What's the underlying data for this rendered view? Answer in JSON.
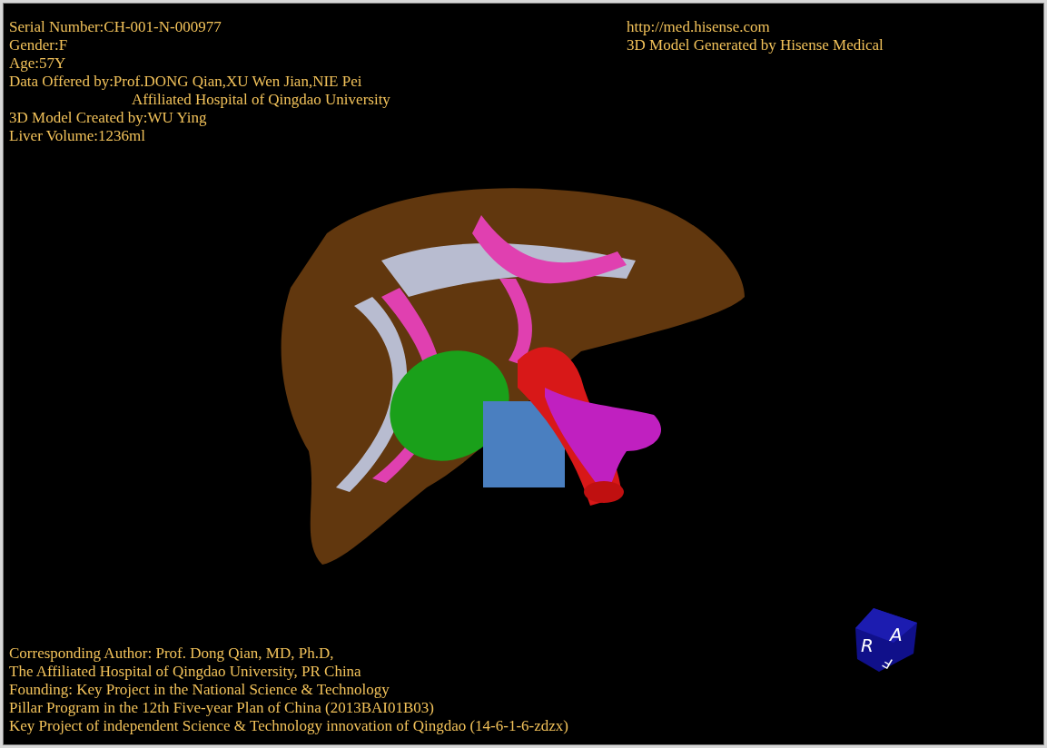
{
  "header_left": [
    {
      "text": "Serial Number:CH-001-N-000977",
      "indent": false
    },
    {
      "text": "Gender:F",
      "indent": false
    },
    {
      "text": "Age:57Y",
      "indent": false
    },
    {
      "text": "Data Offered by:Prof.DONG Qian,XU Wen Jian,NIE Pei",
      "indent": false
    },
    {
      "text": "Affiliated Hospital of Qingdao University",
      "indent": true
    },
    {
      "text": "3D Model Created by:WU Ying",
      "indent": false
    },
    {
      "text": "Liver Volume:1236ml",
      "indent": false
    }
  ],
  "header_right": [
    "http://med.hisense.com",
    "3D Model Generated by Hisense Medical"
  ],
  "model": {
    "kind": "picture"
  },
  "footer": [
    "Corresponding Author: Prof. Dong Qian, MD, Ph.D,",
    "The Affiliated Hospital of Qingdao University, PR China",
    "Founding: Key Project in the National Science & Technology",
    "Pillar Program in the 12th Five-year Plan of China (2013BAI01B03)",
    "Key Project of independent Science & Technology innovation of Qingdao (14-6-1-6-zdzx)"
  ],
  "orientation_cube": {
    "labels": [
      "R",
      "A",
      "F"
    ]
  }
}
